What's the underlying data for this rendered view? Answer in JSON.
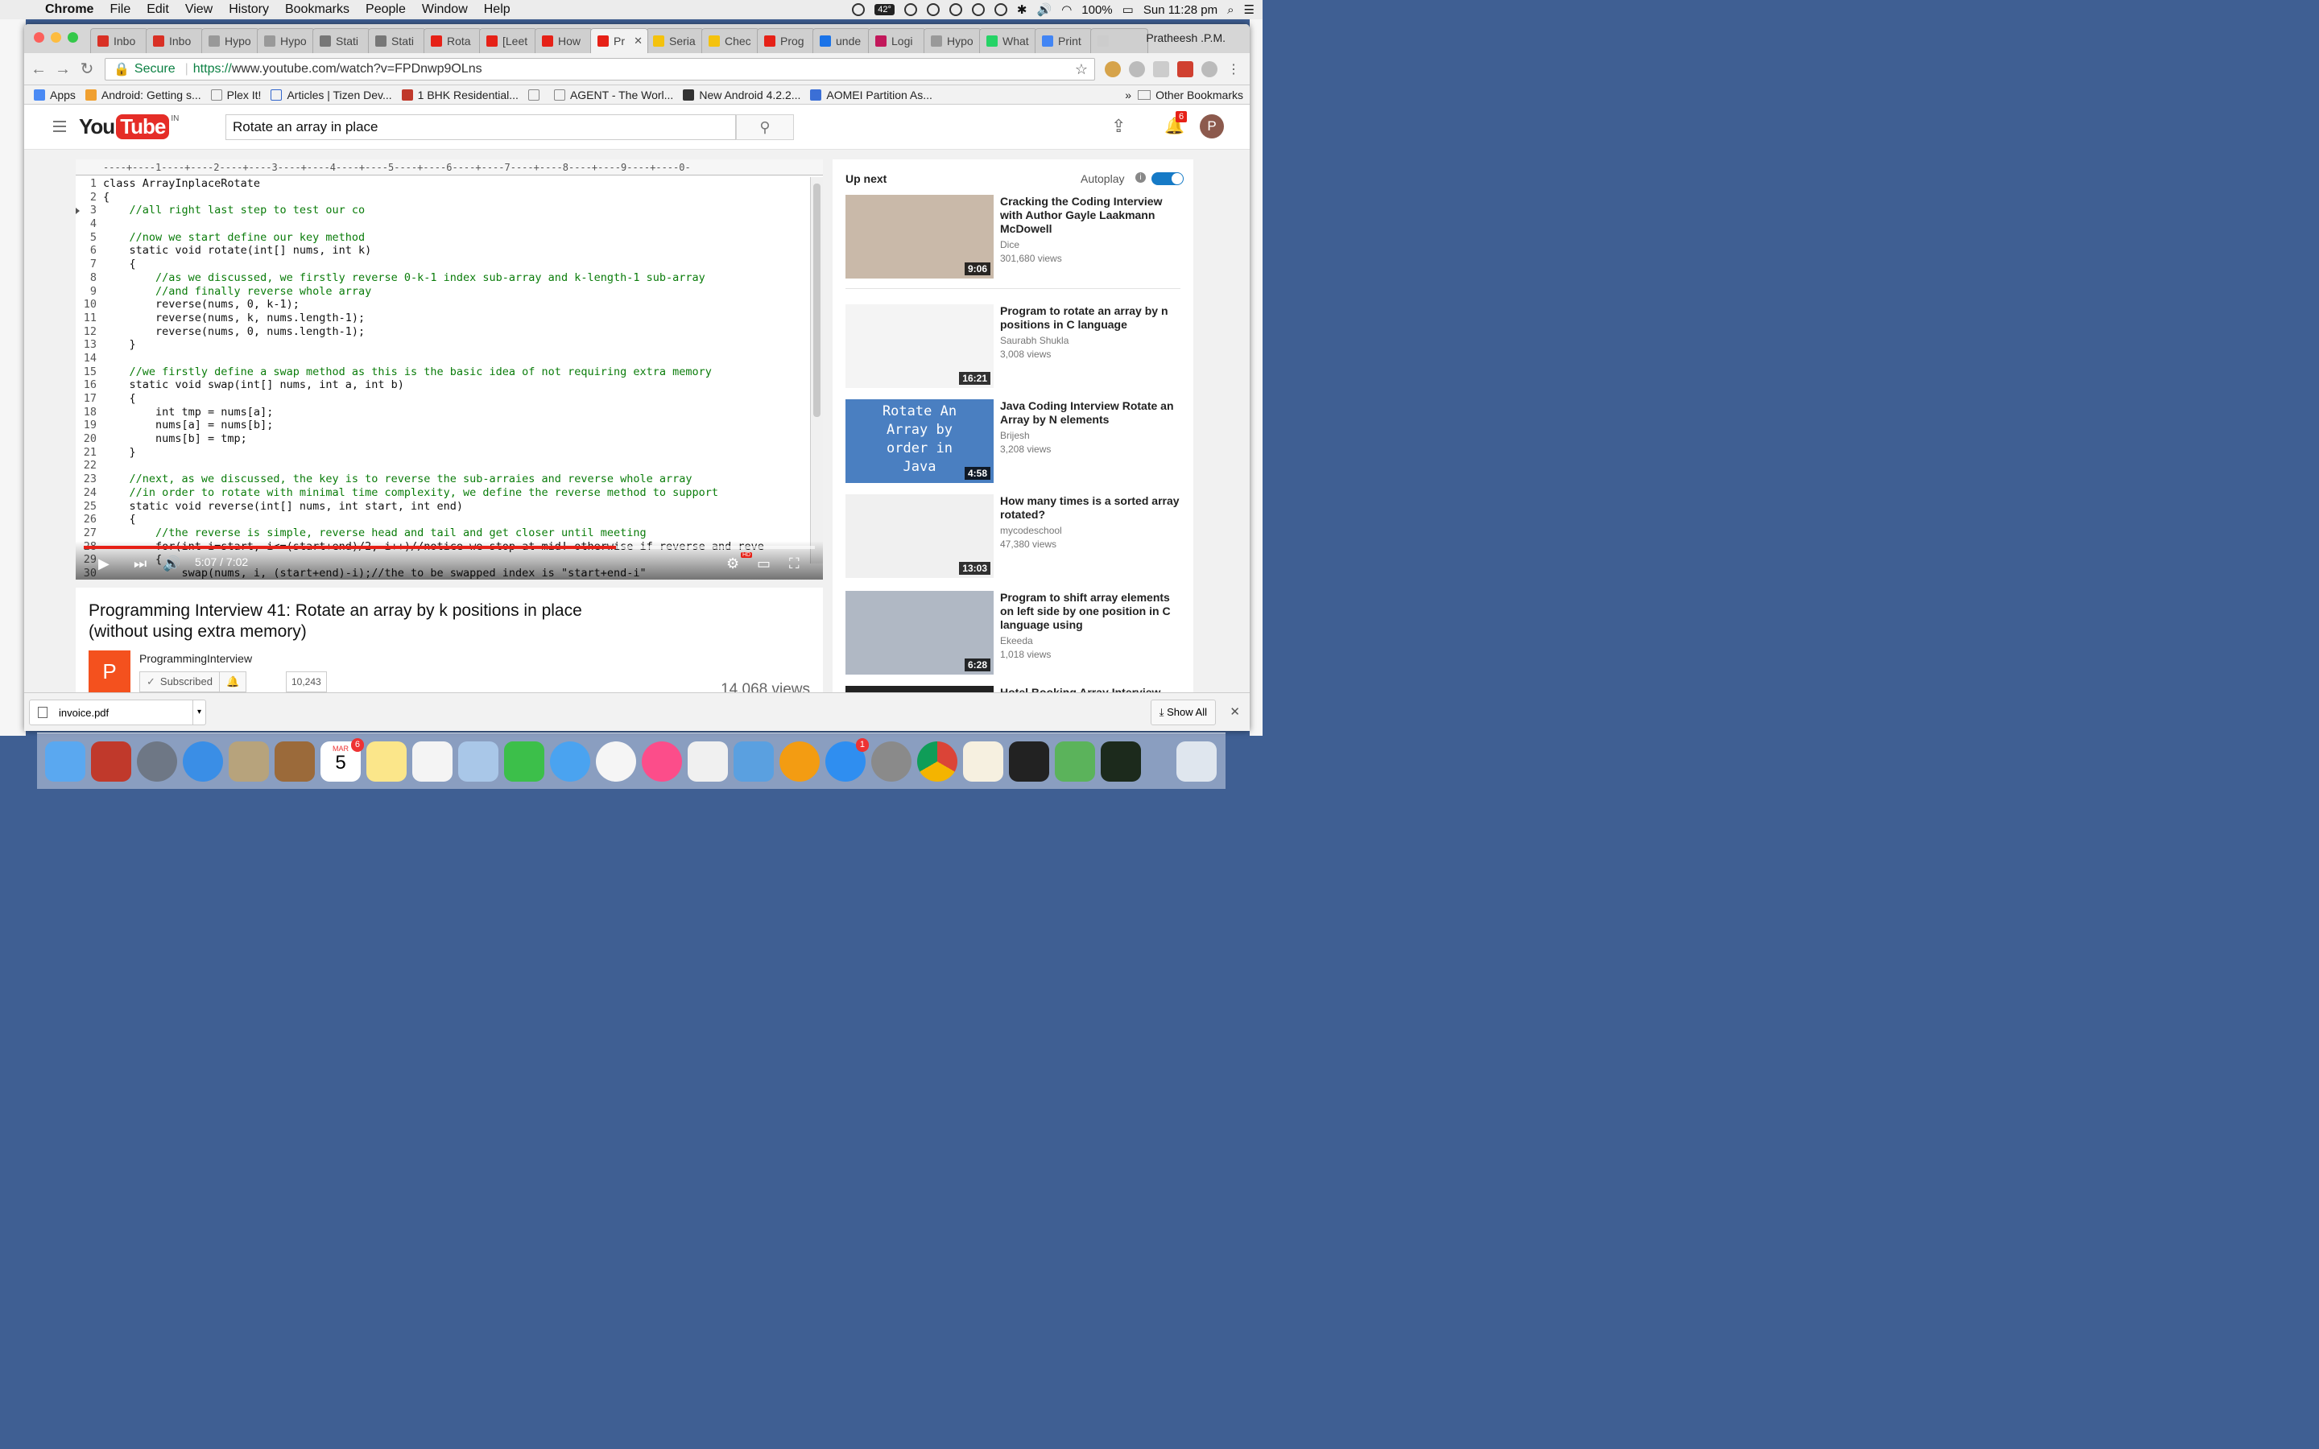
{
  "menubar": {
    "app_name": "Chrome",
    "items": [
      "File",
      "Edit",
      "View",
      "History",
      "Bookmarks",
      "People",
      "Window",
      "Help"
    ],
    "temperature": "42°",
    "battery": "100%",
    "clock": "Sun 11:28 pm"
  },
  "browser": {
    "tabs": [
      {
        "label": "Inbo",
        "icon": "gmail-icon",
        "color": "#d93025"
      },
      {
        "label": "Inbo",
        "icon": "gmail-icon",
        "color": "#d93025"
      },
      {
        "label": "Hypo",
        "icon": "page-icon",
        "color": "#999999"
      },
      {
        "label": "Hypo",
        "icon": "page-icon",
        "color": "#999999"
      },
      {
        "label": "Stati",
        "icon": "loading-icon",
        "color": "#777777"
      },
      {
        "label": "Stati",
        "icon": "loading-icon",
        "color": "#777777"
      },
      {
        "label": "Rota",
        "icon": "youtube-icon",
        "color": "#e62117"
      },
      {
        "label": "[Leet",
        "icon": "youtube-icon",
        "color": "#e62117"
      },
      {
        "label": "How",
        "icon": "youtube-icon",
        "color": "#e62117"
      },
      {
        "label": "Pr",
        "icon": "youtube-icon",
        "color": "#e62117",
        "active": true
      },
      {
        "label": "Seria",
        "icon": "id-icon",
        "color": "#f4c20d"
      },
      {
        "label": "Chec",
        "icon": "id-icon",
        "color": "#f4c20d"
      },
      {
        "label": "Prog",
        "icon": "youtube-icon",
        "color": "#e62117"
      },
      {
        "label": "unde",
        "icon": "page-icon",
        "color": "#1a73e8"
      },
      {
        "label": "Logi",
        "icon": "m-icon",
        "color": "#c2185b"
      },
      {
        "label": "Hypo",
        "icon": "page-icon",
        "color": "#999999"
      },
      {
        "label": "What",
        "icon": "whatsapp-icon",
        "color": "#25d366"
      },
      {
        "label": "Print",
        "icon": "google-icon",
        "color": "#4285f4"
      },
      {
        "label": "",
        "icon": "new-tab-icon",
        "color": "#cccccc"
      }
    ],
    "profile_name": "Pratheesh .P.M.",
    "address": {
      "secure_label": "Secure",
      "scheme": "https://",
      "url": "www.youtube.com/watch?v=FPDnwp9OLns"
    },
    "bookmarks": [
      "Apps",
      "Android: Getting s...",
      "Plex It!",
      "Articles | Tizen Dev...",
      "1 BHK Residential...",
      "",
      "AGENT - The Worl...",
      "New Android 4.2.2...",
      "AOMEI Partition As..."
    ],
    "other_bookmarks": "Other Bookmarks"
  },
  "youtube": {
    "logo_you": "You",
    "logo_tube": "Tube",
    "country": "IN",
    "search_query": "Rotate an array in place",
    "notification_count": "6",
    "avatar_letter": "P"
  },
  "player": {
    "ruler": "----+----1----+----2----+----3----+----4----+----5----+----6----+----7----+----8----+----9----+----0-",
    "code_lines": [
      {
        "n": "1",
        "text": "class ArrayInplaceRotate",
        "type": "code"
      },
      {
        "n": "2",
        "text": "{",
        "type": "code"
      },
      {
        "n": "3",
        "text": "    //all right last step to test our co",
        "type": "comment"
      },
      {
        "n": "4",
        "text": "",
        "type": "code"
      },
      {
        "n": "5",
        "text": "    //now we start define our key method",
        "type": "comment"
      },
      {
        "n": "6",
        "text": "    static void rotate(int[] nums, int k)",
        "type": "code"
      },
      {
        "n": "7",
        "text": "    {",
        "type": "code"
      },
      {
        "n": "8",
        "text": "        //as we discussed, we firstly reverse 0-k-1 index sub-array and k-length-1 sub-array",
        "type": "comment"
      },
      {
        "n": "9",
        "text": "        //and finally reverse whole array",
        "type": "comment"
      },
      {
        "n": "10",
        "text": "        reverse(nums, 0, k-1);",
        "type": "code"
      },
      {
        "n": "11",
        "text": "        reverse(nums, k, nums.length-1);",
        "type": "code"
      },
      {
        "n": "12",
        "text": "        reverse(nums, 0, nums.length-1);",
        "type": "code"
      },
      {
        "n": "13",
        "text": "    }",
        "type": "code"
      },
      {
        "n": "14",
        "text": "",
        "type": "code"
      },
      {
        "n": "15",
        "text": "    //we firstly define a swap method as this is the basic idea of not requiring extra memory",
        "type": "comment"
      },
      {
        "n": "16",
        "text": "    static void swap(int[] nums, int a, int b)",
        "type": "code"
      },
      {
        "n": "17",
        "text": "    {",
        "type": "code"
      },
      {
        "n": "18",
        "text": "        int tmp = nums[a];",
        "type": "code"
      },
      {
        "n": "19",
        "text": "        nums[a] = nums[b];",
        "type": "code"
      },
      {
        "n": "20",
        "text": "        nums[b] = tmp;",
        "type": "code"
      },
      {
        "n": "21",
        "text": "    }",
        "type": "code"
      },
      {
        "n": "22",
        "text": "",
        "type": "code"
      },
      {
        "n": "23",
        "text": "    //next, as we discussed, the key is to reverse the sub-arraies and reverse whole array",
        "type": "comment"
      },
      {
        "n": "24",
        "text": "    //in order to rotate with minimal time complexity, we define the reverse method to support",
        "type": "comment"
      },
      {
        "n": "25",
        "text": "    static void reverse(int[] nums, int start, int end)",
        "type": "code"
      },
      {
        "n": "26",
        "text": "    {",
        "type": "code"
      },
      {
        "n": "27",
        "text": "        //the reverse is simple, reverse head and tail and get closer until meeting",
        "type": "comment"
      },
      {
        "n": "28",
        "text": "        for(int i=start, i<=(start+end)/2, i++)//notice we stop at mid! otherwise if reverse and reve",
        "type": "code"
      },
      {
        "n": "29",
        "text": "        {",
        "type": "code"
      },
      {
        "n": "30",
        "text": "            swap(nums, i, (start+end)-i);//the to be swapped index is \"start+end-i\"",
        "type": "code"
      }
    ],
    "time": "5:07 / 7:02",
    "progress": 0.728,
    "loaded": 1.0
  },
  "video": {
    "title": "Programming Interview 41: Rotate an array by k positions in place (without using extra memory)",
    "channel_letter": "P",
    "channel": "ProgrammingInterview",
    "subscribed_label": "Subscribed",
    "subscriber_count": "10,243",
    "views": "14,068 views"
  },
  "sidebar": {
    "up_next": "Up next",
    "autoplay": "Autoplay",
    "autoplay_on": true,
    "items": [
      {
        "title": "Cracking the Coding Interview with Author Gayle Laakmann McDowell",
        "channel": "Dice",
        "views": "301,680 views",
        "duration": "9:06"
      },
      {
        "title": "Program to rotate an array by n positions in C language",
        "channel": "Saurabh Shukla",
        "views": "3,008 views",
        "duration": "16:21"
      },
      {
        "title": "Java Coding Interview Rotate an Array by N elements",
        "channel": "Brijesh",
        "views": "3,208 views",
        "duration": "4:58",
        "thumb_text": "Rotate An Array by order in Java"
      },
      {
        "title": "How many times is a sorted array rotated?",
        "channel": "mycodeschool",
        "views": "47,380 views",
        "duration": "13:03"
      },
      {
        "title": "Program to shift array elements on left side by one position in C language using",
        "channel": "Ekeeda",
        "views": "1,018 views",
        "duration": "6:28"
      },
      {
        "title": "Hotel Booking Array Interview",
        "channel": "",
        "views": "",
        "duration": ""
      }
    ]
  },
  "downloads": {
    "file": "invoice.pdf",
    "show_all": "Show All"
  },
  "dock": {
    "calendar_month": "MAR",
    "calendar_day": "5",
    "calendar_badge": "6",
    "appstore_badge": "1"
  }
}
